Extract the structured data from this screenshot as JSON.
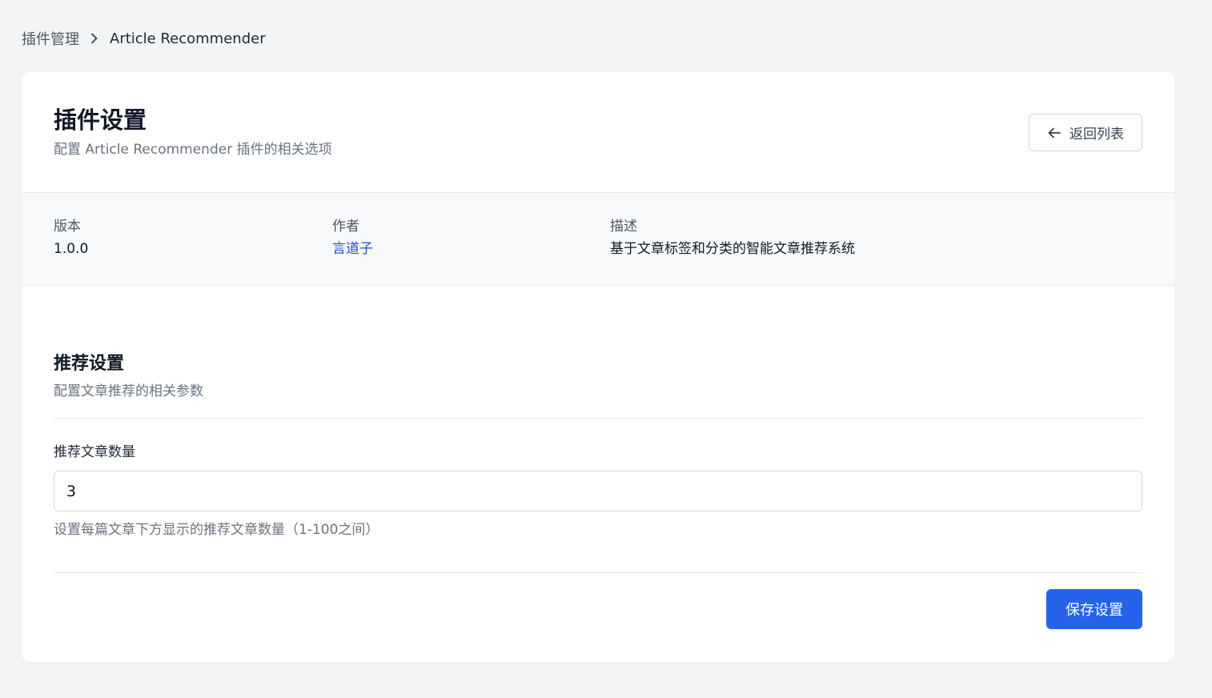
{
  "breadcrumb": {
    "root": "插件管理",
    "current": "Article Recommender"
  },
  "header": {
    "title": "插件设置",
    "subtitle": "配置 Article Recommender 插件的相关选项",
    "back_label": "返回列表"
  },
  "info": {
    "version_label": "版本",
    "version_value": "1.0.0",
    "author_label": "作者",
    "author_value": "言道子",
    "description_label": "描述",
    "description_value": "基于文章标签和分类的智能文章推荐系统"
  },
  "section": {
    "title": "推荐设置",
    "description": "配置文章推荐的相关参数"
  },
  "field": {
    "label": "推荐文章数量",
    "value": "3",
    "help": "设置每篇文章下方显示的推荐文章数量（1-100之间）"
  },
  "actions": {
    "save_label": "保存设置"
  },
  "colors": {
    "primary": "#2563eb",
    "link": "#1d4ed8",
    "background": "#f3f4f6"
  }
}
